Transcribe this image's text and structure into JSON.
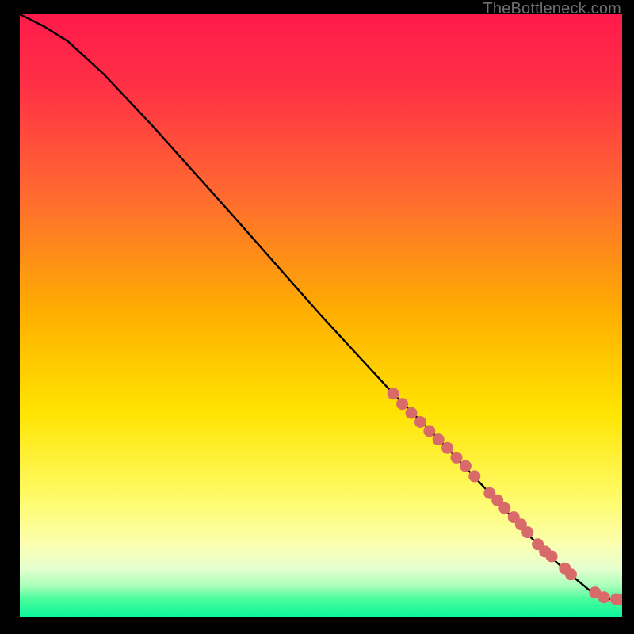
{
  "watermark": "TheBottleneck.com",
  "gradient_stops": [
    {
      "pct": 0,
      "color": "#ff1a4b"
    },
    {
      "pct": 12,
      "color": "#ff3045"
    },
    {
      "pct": 30,
      "color": "#ff6a30"
    },
    {
      "pct": 50,
      "color": "#ffb000"
    },
    {
      "pct": 66,
      "color": "#ffe400"
    },
    {
      "pct": 80,
      "color": "#fffb66"
    },
    {
      "pct": 88,
      "color": "#fbffb0"
    },
    {
      "pct": 92,
      "color": "#e6ffcf"
    },
    {
      "pct": 95,
      "color": "#a6ffb8"
    },
    {
      "pct": 97,
      "color": "#4dfc9e"
    },
    {
      "pct": 100,
      "color": "#0af79a"
    }
  ],
  "chart_data": {
    "type": "line",
    "title": "",
    "xlabel": "",
    "ylabel": "",
    "xlim": [
      0,
      100
    ],
    "ylim": [
      0,
      100
    ],
    "series": [
      {
        "name": "curve",
        "x": [
          0,
          4,
          8,
          14,
          22,
          35,
          50,
          62,
          70,
          78,
          84,
          88,
          92,
          95,
          97,
          100
        ],
        "y": [
          100,
          98,
          95.5,
          90,
          81.5,
          67,
          50,
          37,
          29,
          20.5,
          14,
          10,
          6.5,
          4,
          3,
          2.8
        ]
      }
    ],
    "markers": {
      "name": "highlighted-points",
      "color": "#d86a6a",
      "x": [
        62,
        63.5,
        65,
        66.5,
        68,
        69.5,
        71,
        72.5,
        74,
        75.5,
        78,
        79.3,
        80.5,
        82,
        83.2,
        84.3,
        86,
        87.2,
        88.3,
        90.5,
        91.5,
        95.5,
        97,
        99,
        100
      ],
      "y": [
        37,
        35.3,
        33.8,
        32.3,
        30.8,
        29.4,
        28,
        26.4,
        25,
        23.3,
        20.5,
        19.3,
        18,
        16.5,
        15.3,
        14,
        12,
        10.8,
        10,
        8,
        7,
        4,
        3.2,
        2.9,
        2.8
      ]
    }
  }
}
